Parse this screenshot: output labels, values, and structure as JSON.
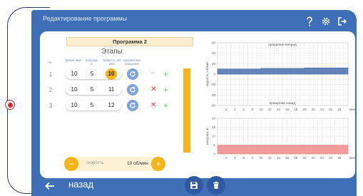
{
  "app_title": "Редактирование программы",
  "program": {
    "name": "Программа 2",
    "stages_title": "Этапы",
    "col_headers": {
      "num": "№",
      "time": "время, мин",
      "load": "нагрузка, кг",
      "speed": "скорость, об/мин",
      "direction": "направление вращения"
    },
    "rows": [
      {
        "n": "1",
        "time": "10",
        "load": "5",
        "speed": "10",
        "selected": true
      },
      {
        "n": "2",
        "time": "10",
        "load": "5",
        "speed": "11",
        "selected": false
      },
      {
        "n": "3",
        "time": "10",
        "load": "5",
        "speed": "12",
        "selected": false
      }
    ],
    "plus": "+",
    "minus": "−",
    "speed_label": "скорость",
    "speed_value": "10 об/мин"
  },
  "charts": {
    "unit_min": "мин",
    "x_ticks": [
      "2",
      "4",
      "6",
      "8",
      "10",
      "12",
      "14",
      "16",
      "18",
      "20",
      "22",
      "24",
      "26",
      "28"
    ],
    "speed_chart": {
      "ylabel": "скорость, об/мин",
      "forward_label": "вращение вперед",
      "backward_label": "вращение назад",
      "y_ticks": [
        "60",
        "40",
        "20",
        "0",
        "-20",
        "-40",
        "-60"
      ]
    },
    "load_chart": {
      "ylabel": "нагрузка, кг",
      "y_ticks": [
        "20",
        "15",
        "10",
        "5",
        "0"
      ]
    }
  },
  "bottom": {
    "back_label": "назад"
  },
  "chart_data": [
    {
      "type": "area",
      "ylabel": "скорость, об/мин",
      "xlabel": "мин",
      "ylim": [
        -60,
        60
      ],
      "xlim": [
        0,
        30
      ],
      "series": [
        {
          "name": "вращение вперед",
          "x": [
            0,
            10,
            20,
            30
          ],
          "values": [
            10,
            11,
            12,
            12
          ]
        },
        {
          "name": "вращение назад",
          "x": [
            0,
            30
          ],
          "values": [
            0,
            0
          ]
        }
      ],
      "color": "#4a6fad"
    },
    {
      "type": "area",
      "ylabel": "нагрузка, кг",
      "xlabel": "мин",
      "ylim": [
        0,
        20
      ],
      "xlim": [
        0,
        30
      ],
      "series": [
        {
          "x": [
            0,
            30
          ],
          "values": [
            5,
            5
          ]
        }
      ],
      "color": "#f08a8a"
    }
  ]
}
